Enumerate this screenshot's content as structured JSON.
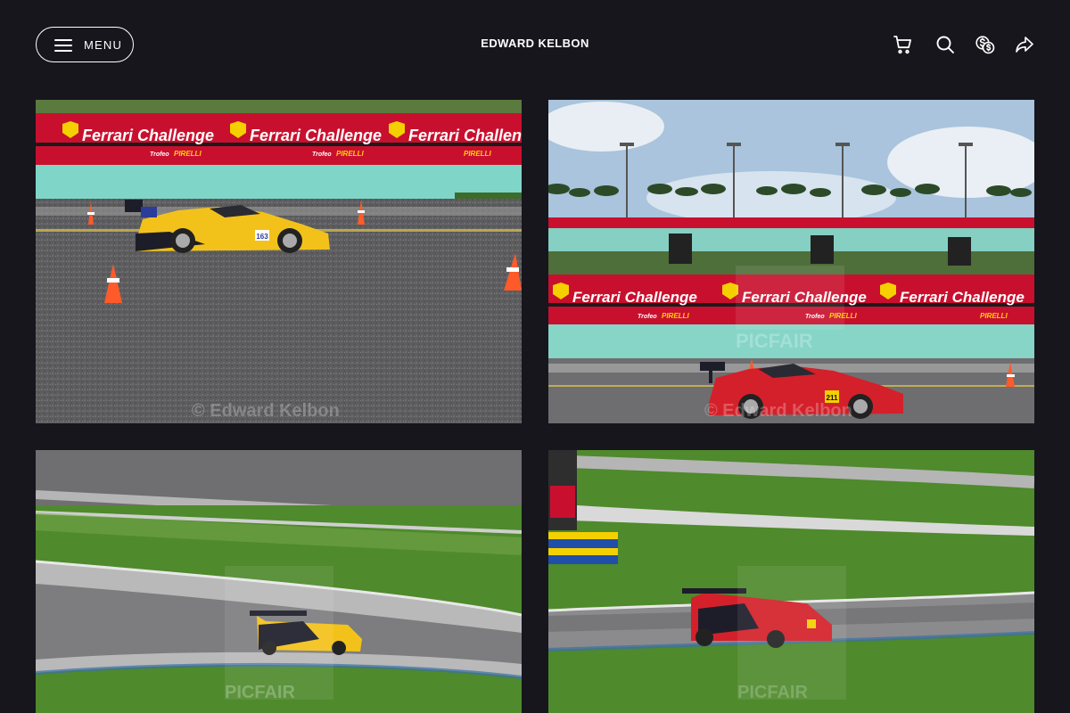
{
  "header": {
    "menu_label": "MENU",
    "title": "EDWARD KELBON",
    "icons": [
      "cart-icon",
      "search-icon",
      "currency-icon",
      "share-icon"
    ]
  },
  "banner": {
    "text": "Ferrari Challenge",
    "subtext_left": "Trofeo",
    "subtext_right": "PIRELLI"
  },
  "watermarks": {
    "credit": "© Edward Kelbon",
    "brand": "PICFAIR"
  },
  "cars": {
    "yellow_number": "163",
    "red_number": "211"
  },
  "colors": {
    "background": "#17161d",
    "banner_red": "#c8102e",
    "wall_teal": "#7fd6c8",
    "grass": "#4f8a2c",
    "asphalt": "#6b6b6b"
  }
}
